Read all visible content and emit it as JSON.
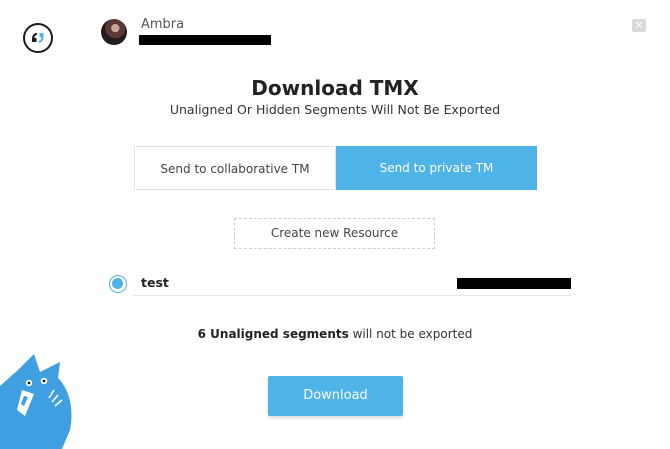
{
  "header": {
    "user_name": "Ambra",
    "close_glyph": "✕",
    "icons": [
      "matecat-logo-icon",
      "user-avatar",
      "close-icon"
    ]
  },
  "dialog": {
    "title": "Download TMX",
    "subtitle": "Unaligned Or Hidden Segments Will Not Be Exported",
    "tabs": [
      {
        "label": "Send to collaborative TM",
        "active": false
      },
      {
        "label": "Send to private TM",
        "active": true
      }
    ],
    "create_resource_label": "Create new Resource",
    "resource": {
      "name": "test",
      "selected": true
    },
    "info": {
      "count_text": "6 Unaligned segments",
      "rest_text": " will not be exported"
    },
    "download_label": "Download"
  },
  "colors": {
    "accent": "#4eb3e7",
    "redaction": "#000000",
    "mascot": "#3f9fe0"
  }
}
